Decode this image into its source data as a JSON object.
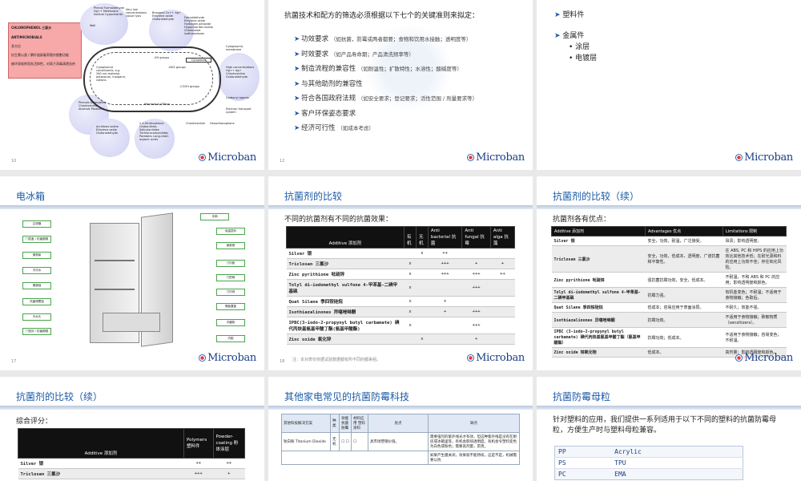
{
  "brand": {
    "logo_text": "Microban",
    "primary_color": "#1b5aa6",
    "logo_color": "#1b3f86"
  },
  "slide1": {
    "note_title": "CHLOROPHENOL 三氯沙",
    "note_sub": "ANTIMICROBIALS",
    "note_items": [
      "多方位",
      "抗生素以类 / 膦杆道屏蔽养殖作细胞功能",
      "被环境吸附而失活抑性，对高于消毒清透含剂"
    ],
    "labels": [
      "Phenol Formaldehyde Hg++ Membrane Sodium hypochlorite",
      "Very low concentrations cause lysis",
      "Bronopol Cu++ Ag+ Ethylene oxide Glutaraldehyde",
      "Formaldehyde Ethylene oxide Hydrogen peroxide Hypochlorites Iodine Chlorinated isothiazolones",
      "Cytoplasmic membrane",
      "Cytoplasmic constituents, e.g. 260 nm-material, potassium, inorganic cations",
      "-SH groups",
      "-NH2 groups",
      "Cytoplasm",
      "-COOH groups",
      "Membrane ATPase",
      "High concentrations Hg++ Ag+ Chlorhexidine Glutaraldehyde",
      "Carbonyl agents",
      "Phenols Detergents Chlorhexidine Alcohols Parabens",
      "Acridines Iodine Ethylene oxide Glutaraldehyde",
      "2,4-Dinitrophenol Carbanilides Salicylanilides Trichlorocarbanilides Parabens Long-chain organic acids",
      "Chlorhexidine",
      "Hexachlorophane",
      "Electron transport system",
      "Wall"
    ],
    "page": "10"
  },
  "slide2": {
    "intro": "抗菌技术和配方的筛选必须根据以下七个的关键准则来拟定：",
    "items": [
      {
        "main": "功效要求",
        "detail": "（如抗菌，防霉或两者都要；食物和饮用水接触；透明度等）"
      },
      {
        "main": "时效要求",
        "detail": "（如产品寿命期；产品清洗频率等）"
      },
      {
        "main": "制造流程的兼容性",
        "detail": "（如耐温性；扩散特性；水溶性；酸碱度等）"
      },
      {
        "main": "与其他助剂的兼容性",
        "detail": ""
      },
      {
        "main": "符合各国政府法规",
        "detail": "（如安全要求；登记要求；活性范围 / 剂量要求等）"
      },
      {
        "main": "客户环保姿态要求",
        "detail": ""
      },
      {
        "main": "经济可行性",
        "detail": "（如成本考虑）"
      }
    ],
    "page": "12"
  },
  "slide3": {
    "items": [
      "塑料件",
      "金属件"
    ],
    "subitems": [
      "涂层",
      "电镀层"
    ]
  },
  "slide4": {
    "title": "电冰箱",
    "callouts_left": [
      "过滤器",
      "门层盖 / 抗菌圈帽",
      "搁物架",
      "冷冻水",
      "果蔬抽",
      "抗菌储蓄抽",
      "冷水头",
      "门密封 / 抗菌圈帽"
    ],
    "callouts_right": [
      "手柄",
      "保温层料",
      "蔬菜框",
      "门内胆",
      "门把柄",
      "门内饰",
      "隔板罩盖",
      "冷藏柜",
      "内胆"
    ],
    "page": "17"
  },
  "slide5": {
    "title": "抗菌剂的比较",
    "intro": "不同的抗菌剂有不同的抗菌效果：",
    "headers": [
      "Additive 添加剂",
      "有机",
      "无机",
      "Anti bacterial 抗菌",
      "Anti fungal 抗霉",
      "Anti alga 抗藻"
    ],
    "rows": [
      [
        "Silver 银",
        "",
        "x",
        "++",
        "",
        ""
      ],
      [
        "Triclosan 三氯沙",
        "x",
        "",
        "+++",
        "+",
        "+"
      ],
      [
        "Zinc pyrithione 吡硫锌",
        "x",
        "",
        "+++",
        "+++",
        "++"
      ],
      [
        "Tolyl di-iodomethyl sulfone 4-甲苯基-二碘甲基砜",
        "x",
        "",
        "",
        "+++",
        ""
      ],
      [
        "Quat Silane 季四铵硅烷",
        "x",
        "",
        "+",
        "",
        ""
      ],
      [
        "Isothiazalinones 异噻唑啉酮",
        "x",
        "",
        "+",
        "+++",
        ""
      ],
      [
        "IPBC(3-iodo-2-propynyl butyl carbamate) 碘代丙炔基氨基甲酸丁酯(氨基甲酸酯)",
        "x",
        "",
        "",
        "+++",
        ""
      ],
      [
        "Zinc oxide 氧化锌",
        "",
        "x",
        "",
        "+",
        ""
      ]
    ],
    "footnote": "注：本对表仅依据试验数据都有所不同的都来组。",
    "page": "18"
  },
  "slide6": {
    "title": "抗菌剂的比较（续）",
    "intro": "抗菌剂各有优点：",
    "headers": [
      "Additive 添加剂",
      "Advantages 优点",
      "Limitations 限制"
    ],
    "rows": [
      [
        "Silver 银",
        "安全，功效，耐温，广泛接受。",
        "昂贵；影响透明度。"
      ],
      [
        "Triclosan 三氯沙",
        "安全，功效，低成本，透明度，广谱抗菌和平衡性。",
        "在 ABS, PC 和 HIPS 的应用上功效比其他技术低；在耐光源和料的应用上功效不佳；存在氧化风险。"
      ],
      [
        "Zinc pyrithione 吡硫锌",
        "强抗菌抗霉功效，安全，低成本。",
        "不耐温，不和 ABS 和 PC 的应用；影响透明度和颜色。"
      ],
      [
        "Tolyl di-iodomethyl sulfone 4-甲苯基-二碘甲基砜",
        "抗霉力强。",
        "有机金变色；不耐温；不适用于食物接触；色取后。"
      ],
      [
        "Quat Silane 季四铵硅烷",
        "低成本；容易应用于表面涂层。",
        "不耐久；效能不强。"
      ],
      [
        "Isothiazalinones 异噻唑啉酮",
        "抗霉功效。",
        "不适用于食物接触；致敏物质（sensitizers）。"
      ],
      [
        "IPBC (3-iodo-2-propynyl butyl carbamate) 碘代丙炔基氨基甲酸丁酯（氨基甲酸酯）",
        "抗霉功效；低成本。",
        "不适用于食物接触；容易变色；不耐温。"
      ],
      [
        "Zinc oxide 锌氧化物",
        "低成本。",
        "高剂量；影响透明度和颜色。"
      ]
    ]
  },
  "slide7": {
    "title": "抗菌剂的比较（续）",
    "intro": "综合评分：",
    "headers": [
      "Additive 添加剂",
      "Polymers 塑料件",
      "Powder-coating 粉体涂层"
    ],
    "rows": [
      [
        "Silver 银",
        "++",
        "++"
      ],
      [
        "Triclosan 三氯沙",
        "+++",
        "+"
      ]
    ]
  },
  "slide8": {
    "title": "其他家电常见的抗菌防霉科技",
    "headers": [
      "其他科技解决方案",
      "种类",
      "抗菌",
      "防霉",
      "材料应用 塑料 涂料",
      "优点",
      "缺点"
    ],
    "rows": [
      [
        "钛白粉 Titanium Dioxide",
        "无机",
        "☐",
        "☐",
        "☐",
        "具市场营销价值。",
        "需要强烈的紫外线光才有效，但这种紫外线是没有在厨房或冰箱里等，有机会影响透明度，有机会令塑料变色为白色或粉色；需要高剂量，昂贵。"
      ],
      [
        "",
        "",
        "",
        "",
        "",
        "",
        "如果产生膜关闭，效果就不能持续，这是不是，机械需要以抗"
      ]
    ],
    "header_group": "效能"
  },
  "slide9": {
    "title": "抗菌防霉母粒",
    "intro": "针对塑料的应用，我们提供一系列适用于以下不同的塑料的抗菌防霉母粒，方便生产时与塑料母粒兼容。",
    "plastics": [
      [
        "PP",
        "Acrylic"
      ],
      [
        "PS",
        "TPU"
      ],
      [
        "PC",
        "EMA"
      ]
    ]
  }
}
